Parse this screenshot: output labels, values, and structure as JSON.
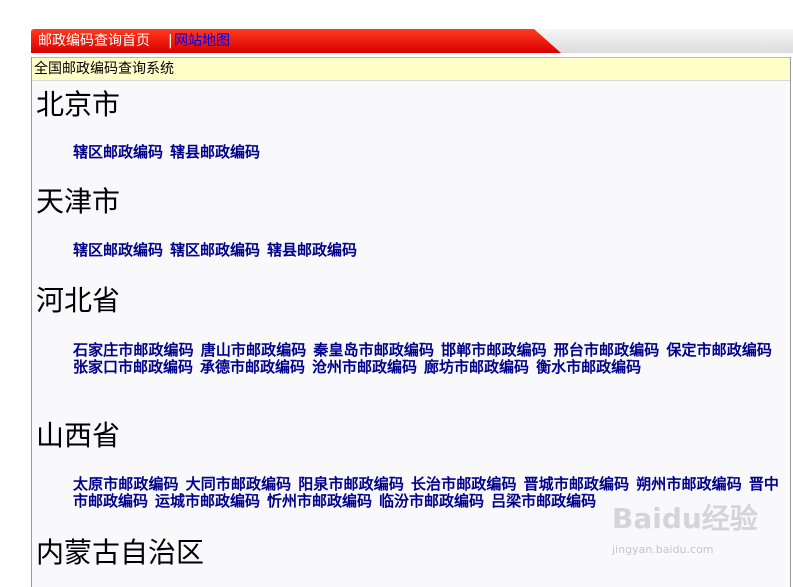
{
  "nav": {
    "home_label": "邮政编码查询首页",
    "separator": "|",
    "sitemap_label": "网站地图"
  },
  "system_title": "全国邮政编码查询系统",
  "provinces": [
    {
      "name": "北京市",
      "links": [
        "辖区邮政编码",
        "辖县邮政编码"
      ]
    },
    {
      "name": "天津市",
      "links": [
        "辖区邮政编码",
        "辖区邮政编码",
        "辖县邮政编码"
      ]
    },
    {
      "name": "河北省",
      "links": [
        "石家庄市邮政编码",
        "唐山市邮政编码",
        "秦皇岛市邮政编码",
        "邯郸市邮政编码",
        "邢台市邮政编码",
        "保定市邮政编码",
        "张家口市邮政编码",
        "承德市邮政编码",
        "沧州市邮政编码",
        "廊坊市邮政编码",
        "衡水市邮政编码"
      ]
    },
    {
      "name": "山西省",
      "links": [
        "太原市邮政编码",
        "大同市邮政编码",
        "阳泉市邮政编码",
        "长治市邮政编码",
        "晋城市邮政编码",
        "朔州市邮政编码",
        "晋中市邮政编码",
        "运城市邮政编码",
        "忻州市邮政编码",
        "临汾市邮政编码",
        "吕梁市邮政编码"
      ]
    },
    {
      "name": "内蒙古自治区",
      "links": []
    }
  ],
  "watermark": {
    "brand": "Baidu经验",
    "url": "jingyan.baidu.com"
  },
  "colors": {
    "tab_red": "#e00000",
    "link_blue": "#00008b",
    "title_bar_yellow": "#ffffc8"
  }
}
